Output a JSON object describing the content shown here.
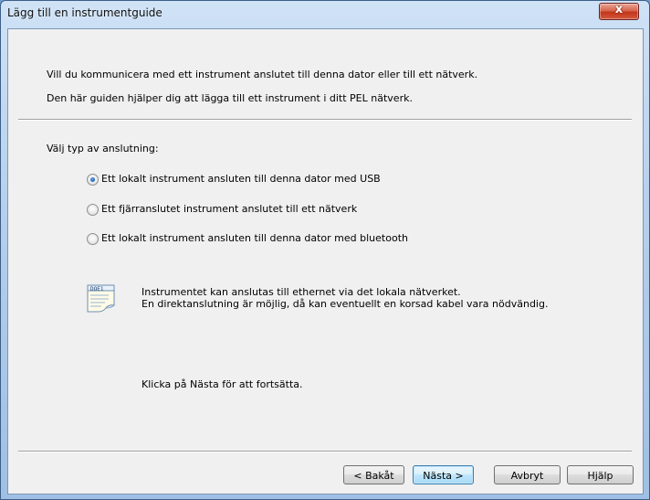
{
  "window": {
    "title": "Lägg till en instrumentguide",
    "close_label": "x"
  },
  "intro": {
    "line1": "Vill du kommunicera med ett instrument anslutet till denna dator eller till ett nätverk.",
    "line2": "Den här guiden hjälper dig att lägga till ett instrument i ditt PEL nätverk."
  },
  "connection": {
    "label": "Välj typ av anslutning:",
    "options": [
      {
        "label": "Ett lokalt instrument ansluten till denna dator med USB",
        "selected": true
      },
      {
        "label": "Ett fjärranslutet instrument anslutet till ett nätverk",
        "selected": false
      },
      {
        "label": "Ett lokalt instrument ansluten till denna dator med bluetooth",
        "selected": false
      }
    ]
  },
  "info": {
    "icon_text": "DOE1",
    "icon": "document-icon",
    "line1": "Instrumentet kan anslutas till ethernet via det lokala nätverket.",
    "line2": "En direktanslutning är möjlig, då kan eventuellt en korsad kabel vara nödvändig."
  },
  "continue_hint": "Klicka på Nästa för att fortsätta.",
  "buttons": {
    "back": "< Bakåt",
    "next": "Nästa >",
    "cancel": "Avbryt",
    "help": "Hjälp"
  }
}
